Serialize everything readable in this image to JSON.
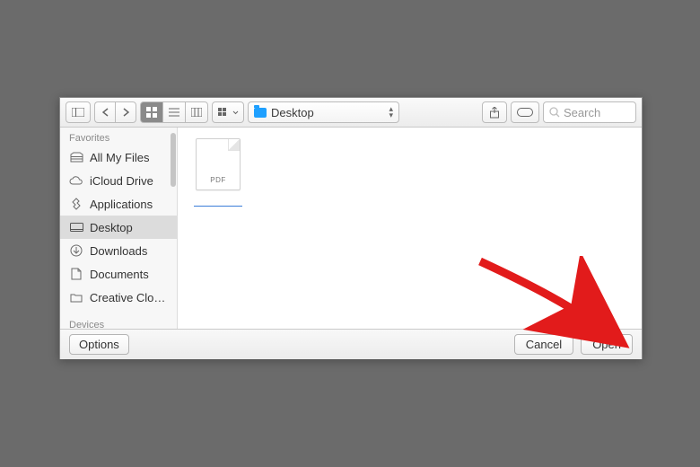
{
  "toolbar": {
    "path_label": "Desktop",
    "search_placeholder": "Search"
  },
  "sidebar": {
    "sections": {
      "favorites": "Favorites",
      "devices": "Devices"
    },
    "items": [
      {
        "label": "All My Files"
      },
      {
        "label": "iCloud Drive"
      },
      {
        "label": "Applications"
      },
      {
        "label": "Desktop"
      },
      {
        "label": "Downloads"
      },
      {
        "label": "Documents"
      },
      {
        "label": "Creative Clou…"
      }
    ]
  },
  "files": [
    {
      "ext": "PDF",
      "name": ""
    }
  ],
  "footer": {
    "options": "Options",
    "cancel": "Cancel",
    "open": "Open"
  }
}
